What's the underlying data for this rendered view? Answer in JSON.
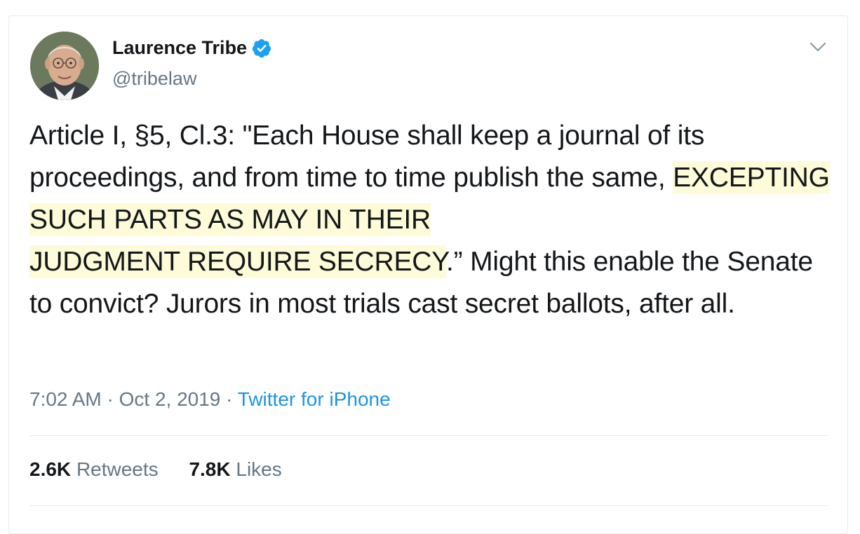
{
  "author": {
    "name": "Laurence Tribe",
    "handle": "@tribelaw",
    "verified": true
  },
  "tweet": {
    "text_before": "Article I, §5, Cl.3: \"Each House shall keep a journal of its proceedings, and from time to time publish the same, ",
    "text_highlight_1": "EXCEPTING SUCH PARTS AS MAY IN THEIR",
    "text_highlight_2": "JUDGMENT REQUIRE SECRECY",
    "text_after": ".” Might this enable the Senate to convict? Jurors in most trials cast secret ballots, after all."
  },
  "meta": {
    "time": "7:02 AM",
    "separator": "·",
    "date": "Oct 2, 2019",
    "source": "Twitter for iPhone"
  },
  "stats": {
    "retweets_count": "2.6K",
    "retweets_label": "Retweets",
    "likes_count": "7.8K",
    "likes_label": "Likes"
  },
  "colors": {
    "verified": "#1da1f2",
    "link": "#1b95e0",
    "muted": "#657786",
    "highlight": "#fdfbd8"
  }
}
